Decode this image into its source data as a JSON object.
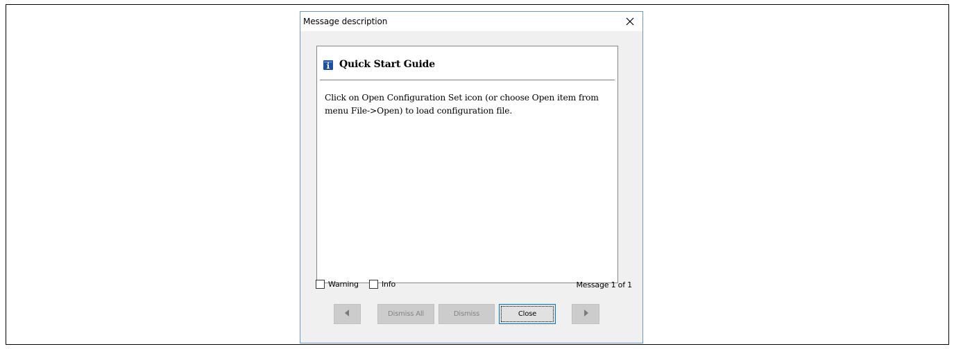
{
  "dialog": {
    "title": "Message description",
    "close_icon": "close-icon"
  },
  "message": {
    "icon": "info-icon",
    "title": "Quick Start Guide",
    "body": "Click on Open Configuration Set icon (or choose Open item from menu File->Open) to load configuration file."
  },
  "filters": {
    "warning_label": "Warning",
    "warning_checked": false,
    "info_label": "Info",
    "info_checked": false
  },
  "counter": {
    "text": "Message 1 of 1"
  },
  "buttons": {
    "previous_icon": "triangle-left-icon",
    "dismiss_all_label": "Dismiss All",
    "dismiss_label": "Dismiss",
    "close_label": "Close",
    "next_icon": "triangle-right-icon"
  },
  "colors": {
    "dialog_border": "#6b98c9",
    "dialog_background": "#f0f0f0",
    "info_icon_blue": "#1e4f9f",
    "close_button_border": "#0078d7",
    "disabled_button": "#cccccc"
  }
}
